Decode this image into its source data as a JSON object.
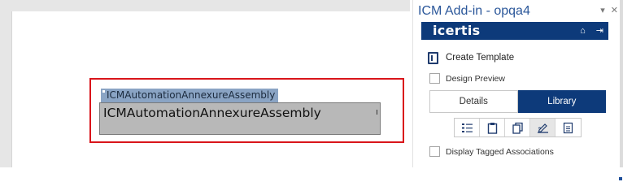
{
  "document": {
    "content_control_tag": "ICMAutomationAnnexureAssembly",
    "content_control_text": "ICMAutomationAnnexureAssembly"
  },
  "taskpane": {
    "title": "ICM Add-in - opqa4",
    "controls": {
      "dropdown_glyph": "▾",
      "close_glyph": "✕"
    },
    "brand": {
      "logo_text": "icertis",
      "color": "#0d3a7a",
      "home_glyph": "⌂",
      "logout_glyph": "⇥"
    },
    "create_template_label": "Create Template",
    "design_preview_label": "Design Preview",
    "tabs": [
      {
        "label": "Details",
        "active": false
      },
      {
        "label": "Library",
        "active": true
      }
    ],
    "icon_toolbar": [
      {
        "name": "list-icon",
        "active": false
      },
      {
        "name": "clipboard-icon",
        "active": false
      },
      {
        "name": "copy-icon",
        "active": false
      },
      {
        "name": "sign-icon",
        "active": true
      },
      {
        "name": "document-icon",
        "active": false
      }
    ],
    "display_tagged_label": "Display Tagged Associations"
  },
  "colors": {
    "highlight_border": "#d9151b",
    "title_blue": "#2b579a",
    "accent": "#0d3a7a"
  }
}
